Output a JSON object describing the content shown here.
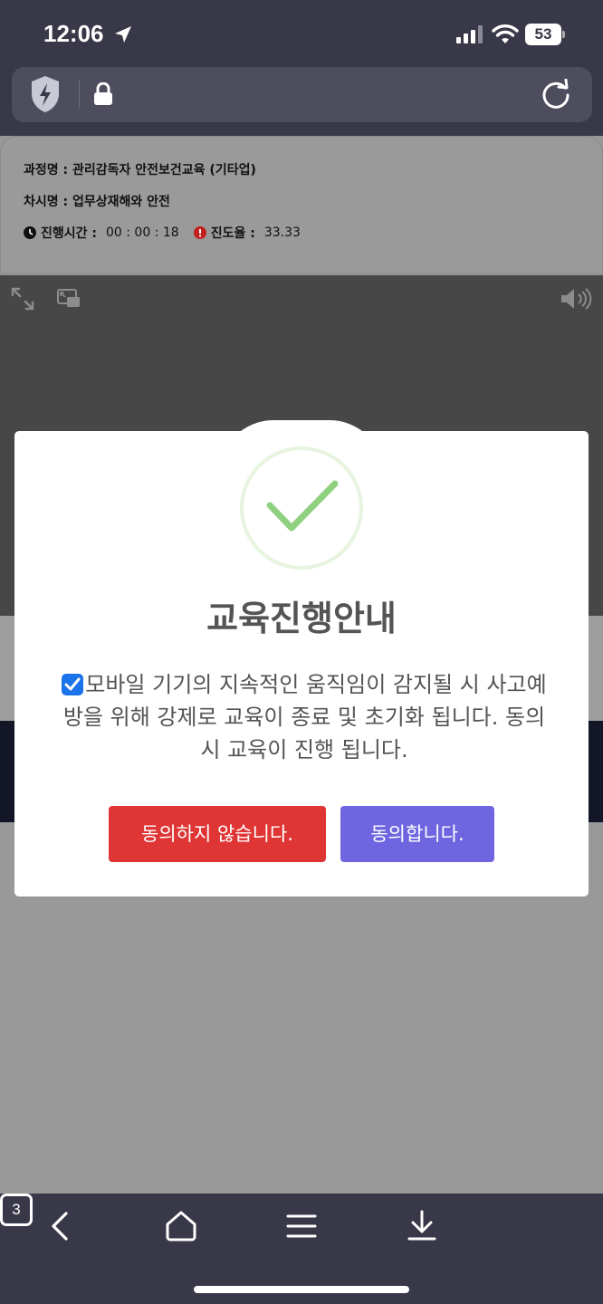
{
  "status_bar": {
    "time": "12:06",
    "battery": "53",
    "icons": [
      "location-arrow-icon",
      "signal-icon",
      "wifi-icon",
      "battery-icon"
    ]
  },
  "browser": {
    "icons": [
      "shield-icon",
      "lock-icon",
      "reload-icon"
    ]
  },
  "course_info": {
    "course_name": "과정명 : 관리감독자 안전보건교육 (기타업)",
    "lesson_name": "차시명 : 업무상재해와 안전",
    "elapsed_label": "진행시간 :",
    "elapsed_value": "00 : 00 : 18",
    "progress_label": "진도율 :",
    "progress_value": "33.33"
  },
  "player": {
    "icons": [
      "expand-icon",
      "picture-in-picture-icon",
      "volume-icon"
    ]
  },
  "modal": {
    "title": "교육진행안내",
    "message": "모바일 기기의 지속적인 움직임이 감지될 시 사고예방을 위해 강제로 교육이 종료 및 초기화 됩니다. 동의시 교육이 진행 됩니다.",
    "checkbox_checked": true,
    "decline_label": "동의하지 않습니다.",
    "agree_label": "동의합니다.",
    "colors": {
      "decline": "#e03535",
      "agree": "#6f65e0",
      "success": "#8fd17f"
    }
  },
  "toolbar": {
    "tab_count": "3",
    "icons": [
      "back-icon",
      "home-icon",
      "menu-icon",
      "download-icon",
      "tabs-icon"
    ]
  }
}
